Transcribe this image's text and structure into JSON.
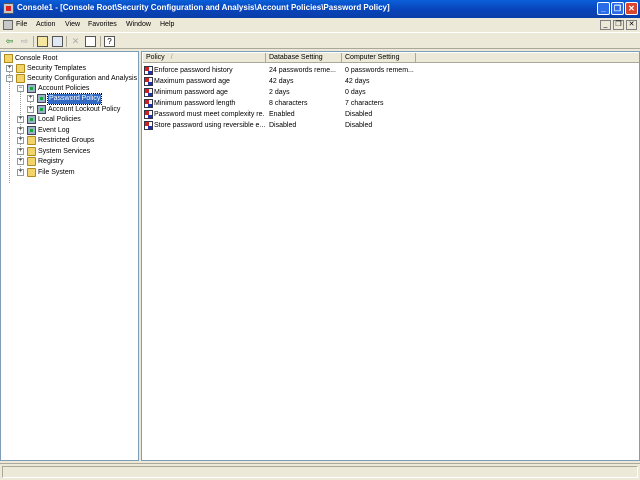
{
  "window": {
    "title": "Console1 - [Console Root\\Security Configuration and Analysis\\Account Policies\\Password Policy]",
    "minimize_glyph": "_",
    "restore_glyph": "❐",
    "close_glyph": "✕"
  },
  "menu": {
    "items": [
      "File",
      "Action",
      "View",
      "Favorites",
      "Window",
      "Help"
    ],
    "mdi_minimize_glyph": "_",
    "mdi_restore_glyph": "❐",
    "mdi_close_glyph": "✕"
  },
  "toolbar": {
    "buttons": [
      "back-icon",
      "forward-icon",
      "up-folder-icon",
      "show-hide-tree-icon",
      "delete-icon",
      "export-list-icon",
      "help-icon"
    ],
    "back_glyph": "⇦",
    "forward_glyph": "⇨",
    "delete_glyph": "✕",
    "help_glyph": "?"
  },
  "tree": {
    "root": "Console Root",
    "items": [
      {
        "label": "Security Templates",
        "expander": "+"
      },
      {
        "label": "Security Configuration and Analysis",
        "expander": "−"
      },
      {
        "label": "Account Policies",
        "expander": "−"
      },
      {
        "label": "Password Policy",
        "expander": "+",
        "selected": true
      },
      {
        "label": "Account Lockout Policy",
        "expander": "+"
      },
      {
        "label": "Local Policies",
        "expander": "+"
      },
      {
        "label": "Event Log",
        "expander": "+"
      },
      {
        "label": "Restricted Groups",
        "expander": "+"
      },
      {
        "label": "System Services",
        "expander": "+"
      },
      {
        "label": "Registry",
        "expander": "+"
      },
      {
        "label": "File System",
        "expander": "+"
      }
    ]
  },
  "list": {
    "columns": [
      "Policy",
      "Database Setting",
      "Computer Setting"
    ],
    "sort_glyph": "/",
    "rows": [
      {
        "policy": "Enforce password history",
        "database": "24 passwords reme...",
        "computer": "0 passwords remem..."
      },
      {
        "policy": "Maximum password age",
        "database": "42 days",
        "computer": "42 days"
      },
      {
        "policy": "Minimum password age",
        "database": "2 days",
        "computer": "0 days"
      },
      {
        "policy": "Minimum password length",
        "database": "8 characters",
        "computer": "7 characters"
      },
      {
        "policy": "Password must meet complexity re...",
        "database": "Enabled",
        "computer": "Disabled"
      },
      {
        "policy": "Store password using reversible e...",
        "database": "Disabled",
        "computer": "Disabled"
      }
    ]
  },
  "colors": {
    "titlebar": "#0843b8",
    "selection": "#316ac5",
    "chrome": "#ece9d8"
  }
}
